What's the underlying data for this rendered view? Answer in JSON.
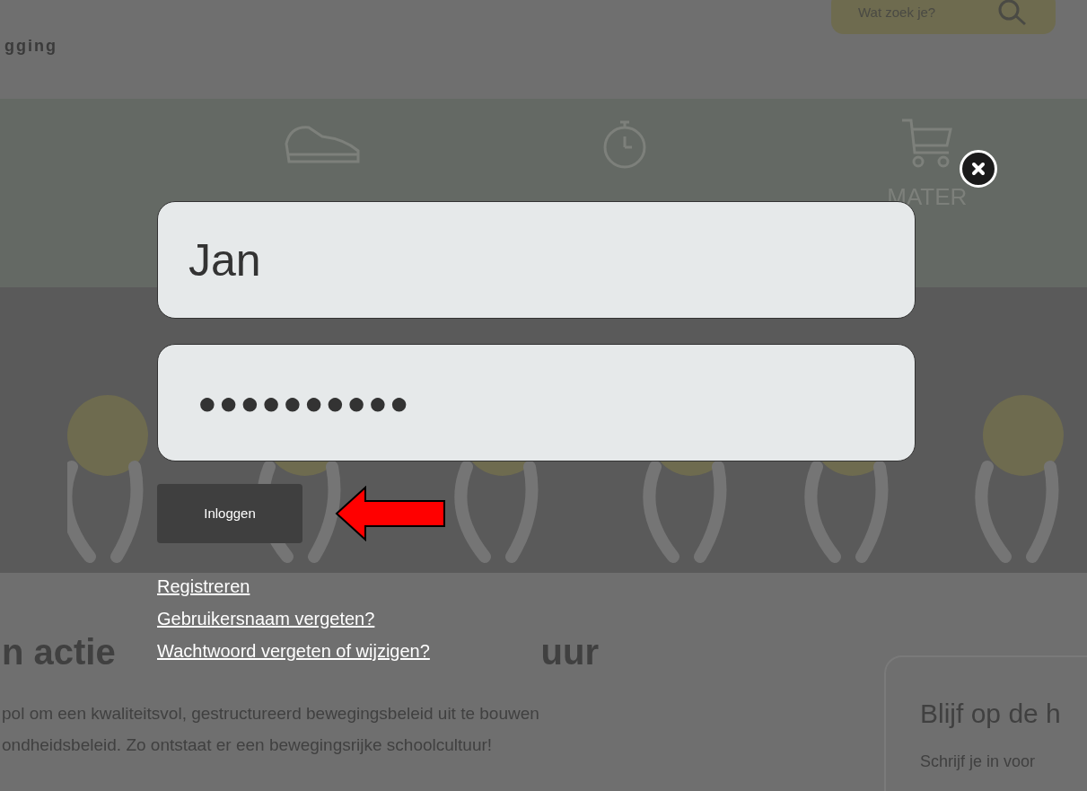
{
  "header": {
    "logo_text": "gging",
    "search": {
      "placeholder": "Wat zoek je?"
    }
  },
  "nav": {
    "items": [
      {
        "kind": "shoe"
      },
      {
        "kind": "stopwatch"
      },
      {
        "kind": "cart",
        "label": "MATER"
      }
    ]
  },
  "content": {
    "heading": [
      "n actie",
      "uur"
    ],
    "paragraph": [
      "pol om een kwaliteitsvol, gestructureerd bewegingsbeleid uit te bouwen",
      "ondheidsbeleid. Zo ontstaat er een bewegingsrijke schoolcultuur!"
    ],
    "card": {
      "title": "Blijf op de h",
      "text": "Schrijf je in voor"
    }
  },
  "login": {
    "username": {
      "value": "Jan"
    },
    "password": {
      "value": "●●●●●●●●●●"
    },
    "button": "Inloggen",
    "annotation_arrow": true,
    "links": [
      "Registreren",
      "Gebruikersnaam vergeten?",
      "Wachtwoord vergeten of wijzigen?"
    ]
  }
}
